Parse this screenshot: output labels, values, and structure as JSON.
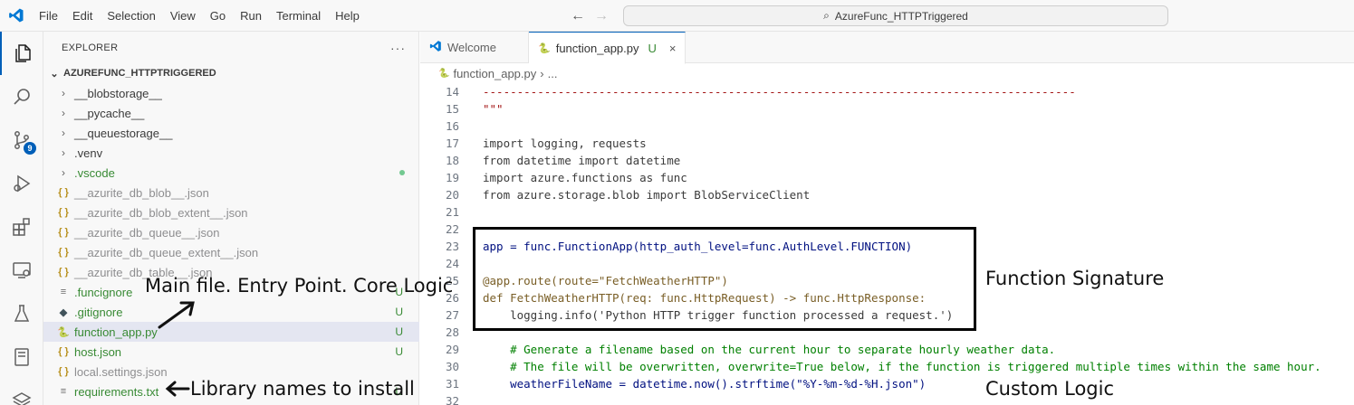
{
  "titlebar": {
    "menu": [
      "File",
      "Edit",
      "Selection",
      "View",
      "Go",
      "Run",
      "Terminal",
      "Help"
    ],
    "search_text": "AzureFunc_HTTPTriggered"
  },
  "activitybar": {
    "items": [
      "explorer-icon",
      "search-icon",
      "source-control-icon",
      "run-debug-icon",
      "extensions-icon",
      "remote-explorer-icon",
      "testing-icon",
      "notebook-icon",
      "layers-icon"
    ],
    "scm_badge": "9"
  },
  "sidebar": {
    "title": "EXPLORER",
    "more": "···",
    "folder": "AZUREFUNC_HTTPTRIGGERED",
    "items": [
      {
        "label": "__blobstorage__",
        "type": "folder",
        "icon": "chevron-right-icon"
      },
      {
        "label": "__pycache__",
        "type": "folder",
        "icon": "chevron-right-icon"
      },
      {
        "label": "__queuestorage__",
        "type": "folder",
        "icon": "chevron-right-icon"
      },
      {
        "label": ".venv",
        "type": "folder",
        "icon": "chevron-right-icon"
      },
      {
        "label": ".vscode",
        "type": "folder",
        "icon": "chevron-right-icon",
        "dot": true
      },
      {
        "label": "__azurite_db_blob__.json",
        "type": "json",
        "icon": "{ }"
      },
      {
        "label": "__azurite_db_blob_extent__.json",
        "type": "json",
        "icon": "{ }"
      },
      {
        "label": "__azurite_db_queue__.json",
        "type": "json",
        "icon": "{ }"
      },
      {
        "label": "__azurite_db_queue_extent__.json",
        "type": "json",
        "icon": "{ }"
      },
      {
        "label": "__azurite_db_table__.json",
        "type": "json",
        "icon": "{ }"
      },
      {
        "label": ".funcignore",
        "type": "txt",
        "icon": "≡",
        "status": "U"
      },
      {
        "label": ".gitignore",
        "type": "git",
        "icon": "◆",
        "status": "U"
      },
      {
        "label": "function_app.py",
        "type": "py",
        "icon": "py",
        "status": "U",
        "selected": true
      },
      {
        "label": "host.json",
        "type": "json",
        "icon": "{ }",
        "status": "U"
      },
      {
        "label": "local.settings.json",
        "type": "json",
        "icon": "{ }"
      },
      {
        "label": "requirements.txt",
        "type": "txt",
        "icon": "≡",
        "status": "U"
      }
    ]
  },
  "editor": {
    "tabs": [
      {
        "label": "Welcome",
        "active": false
      },
      {
        "label": "function_app.py",
        "active": true,
        "status": "U",
        "close": "×"
      }
    ],
    "breadcrumb": {
      "file": "function_app.py",
      "rest": "..."
    },
    "lines": [
      {
        "n": "14",
        "t": "---------------------------------------------------------------------------------------"
      },
      {
        "n": "15",
        "t": "\"\"\""
      },
      {
        "n": "16",
        "t": ""
      },
      {
        "n": "17",
        "t": "import logging, requests"
      },
      {
        "n": "18",
        "t": "from datetime import datetime"
      },
      {
        "n": "19",
        "t": "import azure.functions as func"
      },
      {
        "n": "20",
        "t": "from azure.storage.blob import BlobServiceClient"
      },
      {
        "n": "21",
        "t": ""
      },
      {
        "n": "22",
        "t": ""
      },
      {
        "n": "23",
        "t": "app = func.FunctionApp(http_auth_level=func.AuthLevel.FUNCTION)"
      },
      {
        "n": "24",
        "t": ""
      },
      {
        "n": "25",
        "t": "@app.route(route=\"FetchWeatherHTTP\")"
      },
      {
        "n": "26",
        "t": "def FetchWeatherHTTP(req: func.HttpRequest) -> func.HttpResponse:"
      },
      {
        "n": "27",
        "t": "    logging.info('Python HTTP trigger function processed a request.')"
      },
      {
        "n": "28",
        "t": ""
      },
      {
        "n": "29",
        "t": "    # Generate a filename based on the current hour to separate hourly weather data."
      },
      {
        "n": "30",
        "t": "    # The file will be overwritten, overwrite=True below, if the function is triggered multiple times within the same hour."
      },
      {
        "n": "31",
        "t": "    weatherFileName = datetime.now().strftime(\"%Y-%m-%d-%H.json\")"
      },
      {
        "n": "32",
        "t": ""
      }
    ]
  },
  "annotations": {
    "main_file": "Main file. Entry Point. Core Logic",
    "function_signature": "Function Signature",
    "library_names": "Library names to install",
    "custom_logic": "Custom Logic"
  },
  "colors": {
    "accent": "#005fb8",
    "untracked": "#388a34",
    "keyword": "#af00db",
    "string": "#a31515",
    "comment": "#008000"
  }
}
